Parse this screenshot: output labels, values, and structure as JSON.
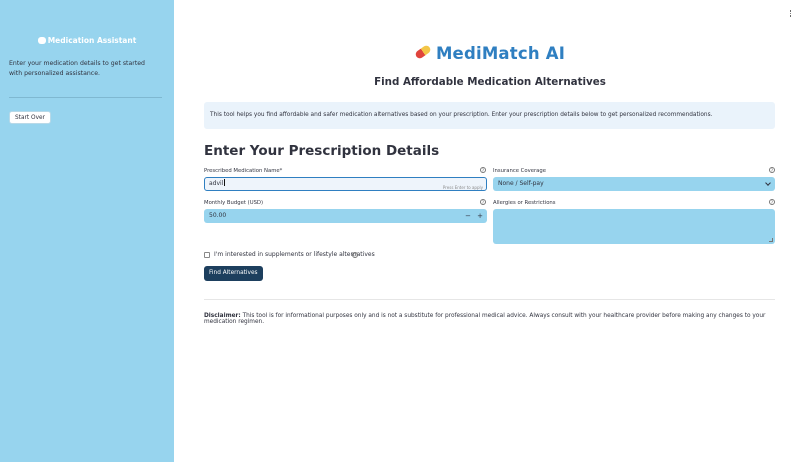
{
  "sidebar": {
    "title": "Medication Assistant",
    "title_icon": "speech-bubble-icon",
    "intro": "Enter your medication details to get started with personalized assistance.",
    "start_over_label": "Start Over"
  },
  "header": {
    "logo_icon": "pill-icon",
    "app_title": "MediMatch AI",
    "subtitle": "Find Affordable Medication Alternatives"
  },
  "info": {
    "text": "This tool helps you find affordable and safer medication alternatives based on your prescription. Enter your prescription details below to get personalized recommendations."
  },
  "form": {
    "section_title": "Enter Your Prescription Details",
    "medication_label": "Prescribed Medication Name*",
    "medication_value": "advil",
    "medication_hint": "Press Enter to apply",
    "insurance_label": "Insurance Coverage",
    "insurance_value": "None / Self-pay",
    "budget_label": "Monthly Budget (USD)",
    "budget_value": "50.00",
    "minus_label": "−",
    "plus_label": "+",
    "allergies_label": "Allergies or Restrictions",
    "allergies_value": "",
    "supplements_label": "I'm interested in supplements or lifestyle alternatives",
    "supplements_checked": false,
    "help_glyph": "?",
    "submit_label": "Find Alternatives"
  },
  "disclaimer": {
    "lead": "Disclaimer:",
    "text": " This tool is for informational purposes only and is not a substitute for professional medical advice. Always consult with your healthcare provider before making any changes to your medication regimen."
  },
  "colors": {
    "sidebar_bg": "#97d4ee",
    "field_bg": "#97d4ee",
    "title_blue": "#2f7fc1",
    "button_dark": "#1d3f5e",
    "info_bg": "#eaf3fb"
  }
}
